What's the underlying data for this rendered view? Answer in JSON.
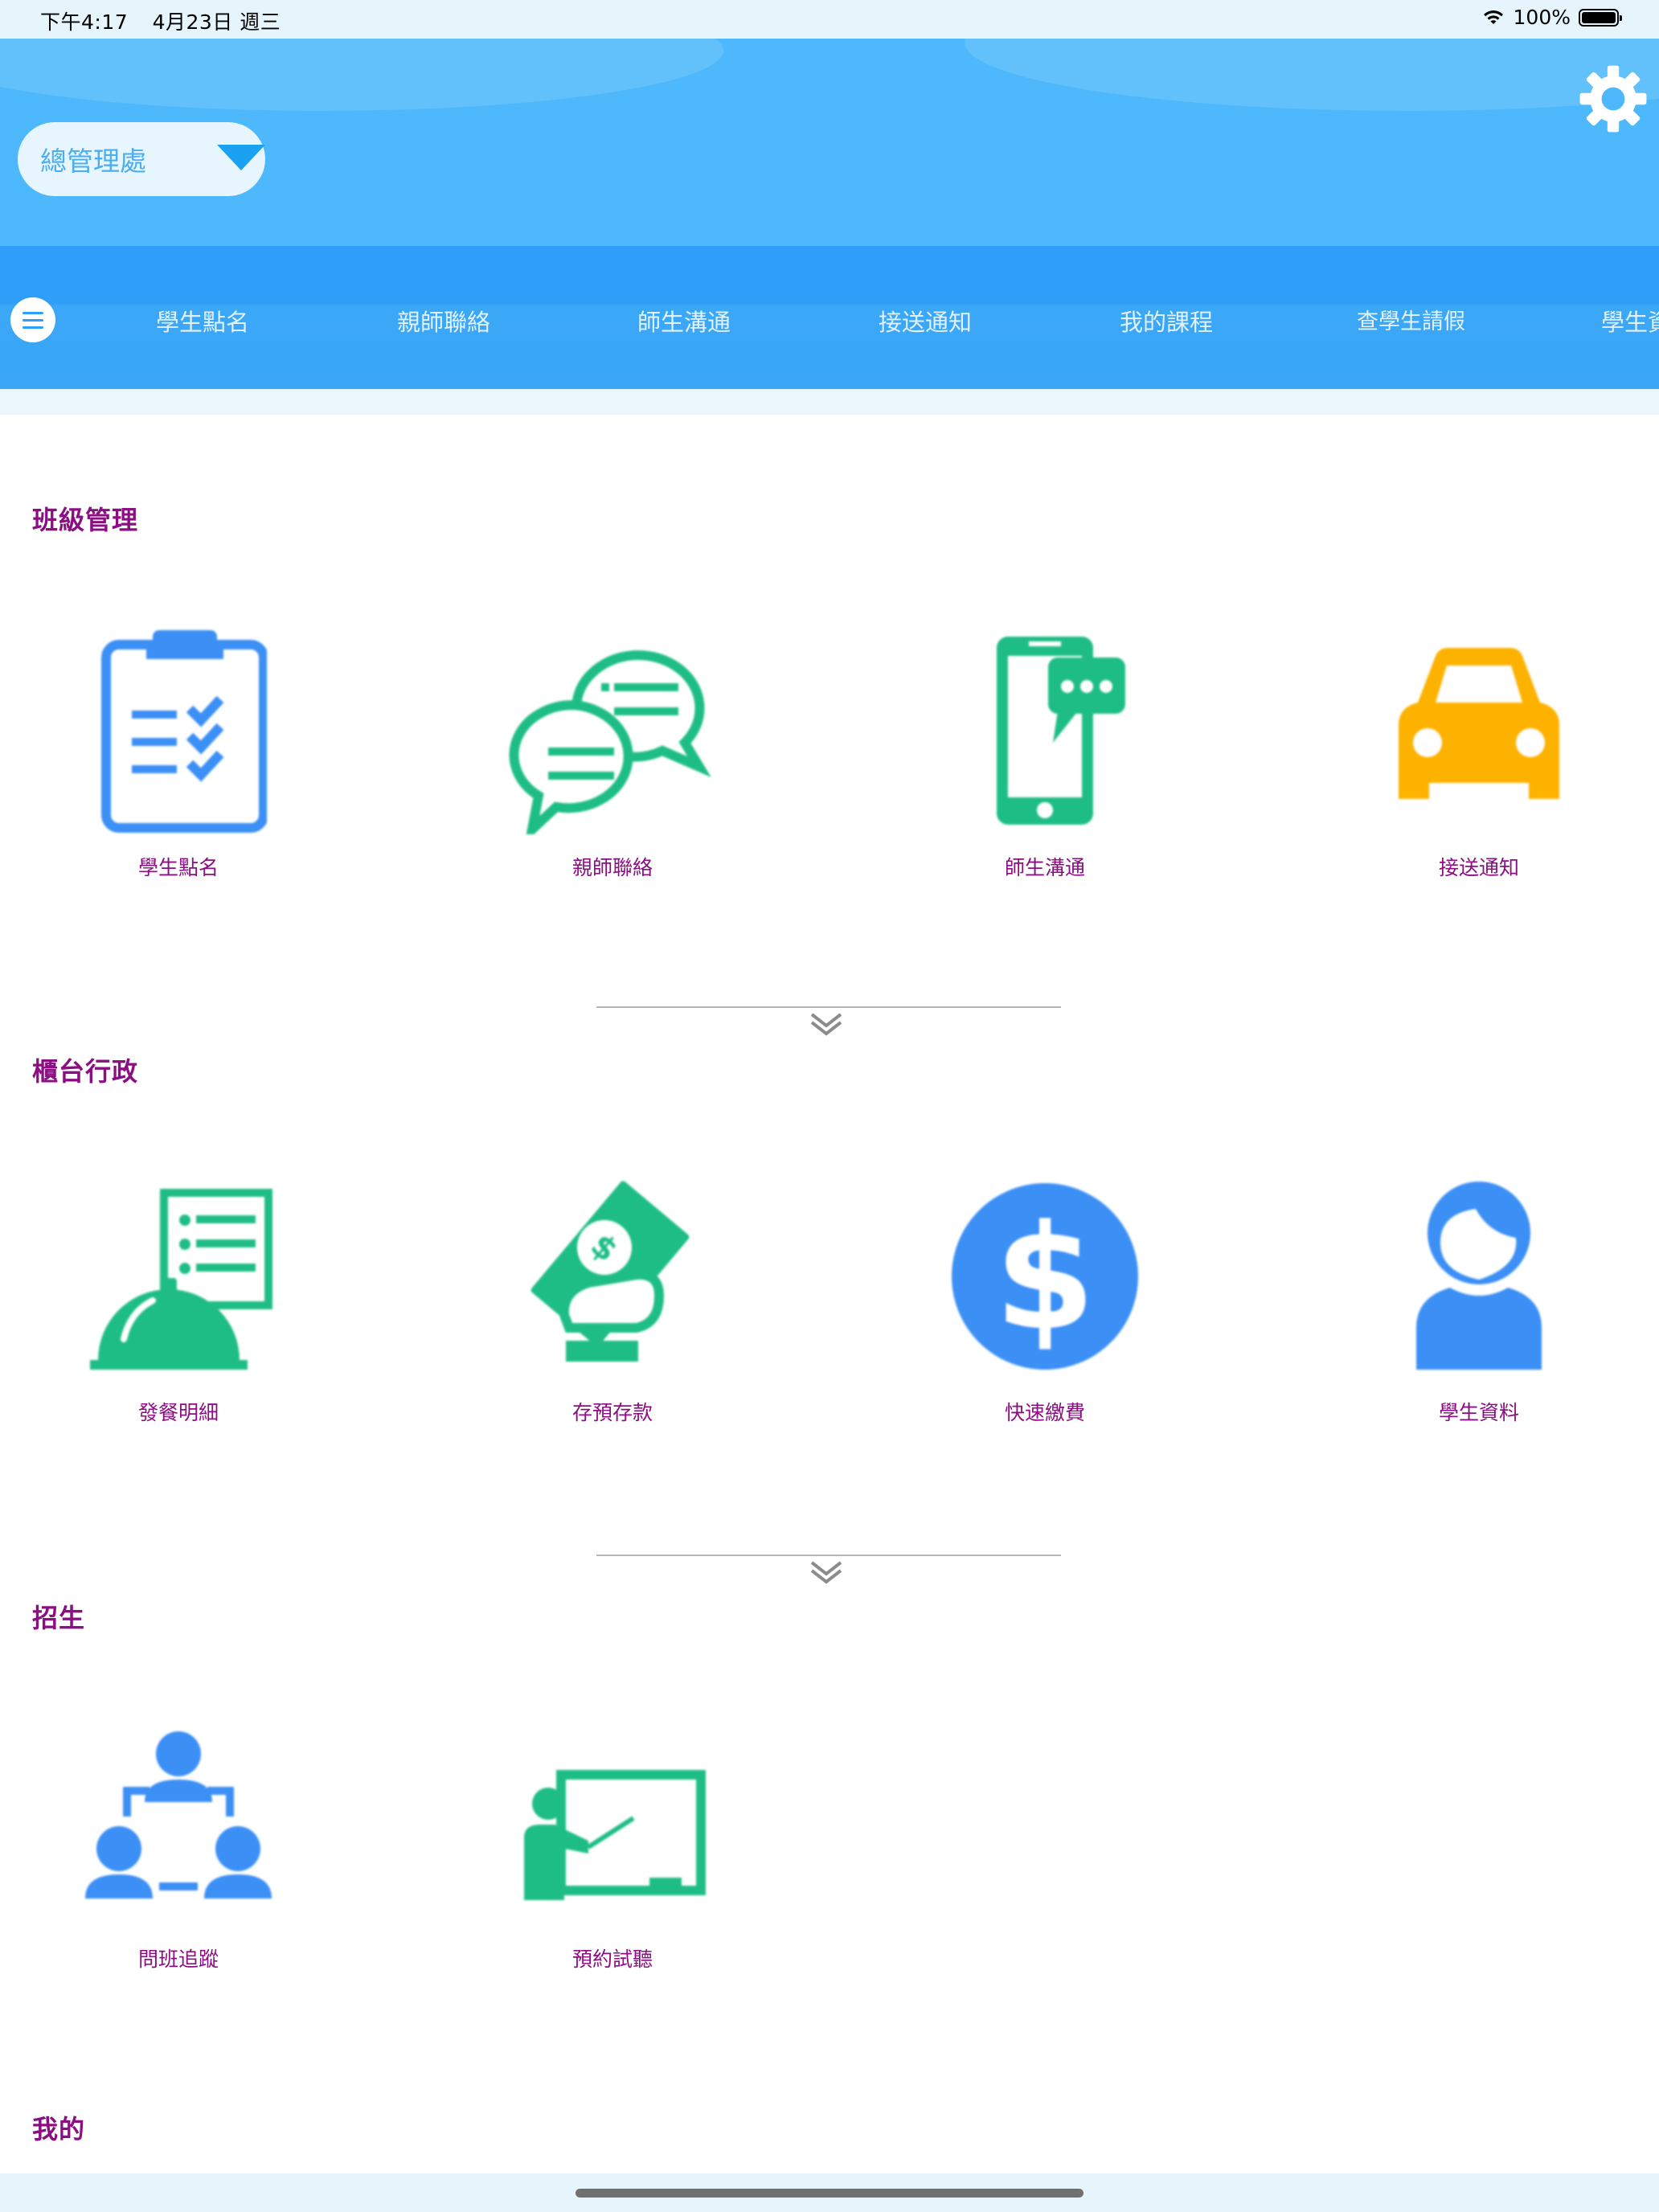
{
  "status_bar": {
    "time": "下午4:17",
    "date": "4月23日 週三",
    "battery": "100%",
    "icons": [
      "wifi-icon",
      "battery-icon"
    ]
  },
  "header": {
    "branch_select": "總管理處",
    "icons": [
      "settings-gear-icon",
      "dropdown-caret-icon"
    ]
  },
  "nav": {
    "tabs": [
      "學生點名",
      "親師聯絡",
      "師生溝通",
      "接送通知",
      "我的課程",
      "查學生請假",
      "學生資"
    ],
    "icons": [
      "menu-icon"
    ]
  },
  "sections": [
    {
      "title": "班級管理",
      "items": [
        {
          "label": "學生點名",
          "icon": "clipboard-checklist-icon",
          "color": "#3b8ff5"
        },
        {
          "label": "親師聯絡",
          "icon": "chat-bubbles-icon",
          "color": "#1fbd86"
        },
        {
          "label": "師生溝通",
          "icon": "phone-message-icon",
          "color": "#1fbd86"
        },
        {
          "label": "接送通知",
          "icon": "car-icon",
          "color": "#fdb200"
        }
      ]
    },
    {
      "title": "櫃台行政",
      "items": [
        {
          "label": "發餐明細",
          "icon": "food-cloche-menu-icon",
          "color": "#1fbd86"
        },
        {
          "label": "存預存款",
          "icon": "hand-money-icon",
          "color": "#1fbd86"
        },
        {
          "label": "快速繳費",
          "icon": "dollar-coin-icon",
          "color": "#3b8ff5"
        },
        {
          "label": "學生資料",
          "icon": "student-profile-icon",
          "color": "#3b8ff5"
        }
      ]
    },
    {
      "title": "招生",
      "items": [
        {
          "label": "問班追蹤",
          "icon": "people-network-icon",
          "color": "#3b8ff5"
        },
        {
          "label": "預約試聽",
          "icon": "teacher-blackboard-icon",
          "color": "#1fbd86"
        }
      ]
    },
    {
      "title": "我的",
      "items": []
    }
  ],
  "colors": {
    "header_bg": "#4db8fb",
    "nav_bg": "#2e9ef8",
    "section_title": "#8b0f82",
    "blue_icon": "#3b8ff5",
    "green_icon": "#1fbd86",
    "orange_icon": "#fdb200"
  }
}
